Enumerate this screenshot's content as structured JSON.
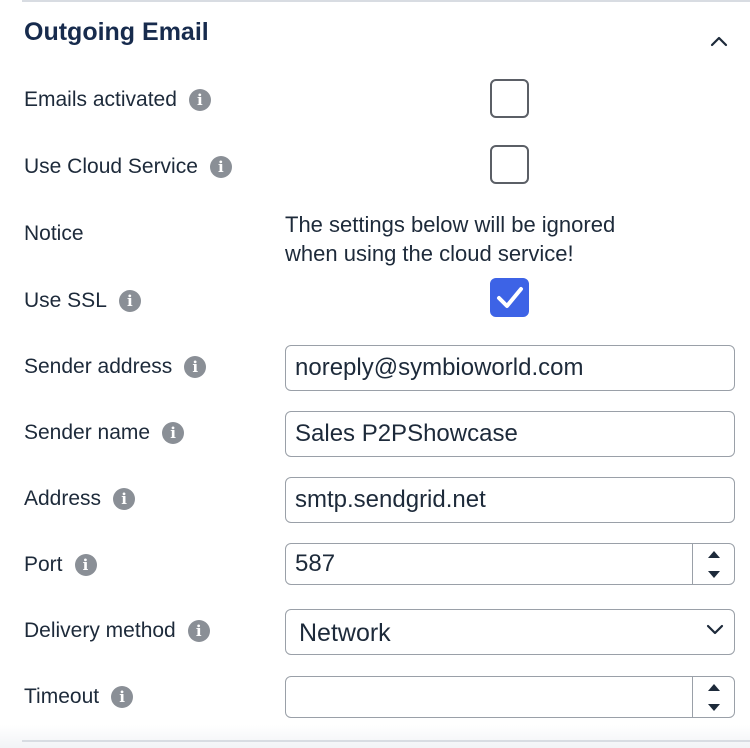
{
  "section": {
    "title": "Outgoing Email"
  },
  "fields": {
    "emails_activated": {
      "label": "Emails activated",
      "checked": false
    },
    "use_cloud_service": {
      "label": "Use Cloud Service",
      "checked": false
    },
    "notice": {
      "label": "Notice",
      "text_line1": "The settings below will be ignored",
      "text_line2": "when using the cloud service!"
    },
    "use_ssl": {
      "label": "Use SSL",
      "checked": true
    },
    "sender_address": {
      "label": "Sender address",
      "value": "noreply@symbioworld.com"
    },
    "sender_name": {
      "label": "Sender name",
      "value": "Sales P2PShowcase"
    },
    "address": {
      "label": "Address",
      "value": "smtp.sendgrid.net"
    },
    "port": {
      "label": "Port",
      "value": "587"
    },
    "delivery_method": {
      "label": "Delivery method",
      "value": "Network"
    },
    "timeout": {
      "label": "Timeout",
      "value": ""
    }
  },
  "icons": {
    "info": "info-icon",
    "collapse": "chevron-up-icon",
    "dropdown": "chevron-down-icon",
    "check": "checkmark-icon"
  },
  "colors": {
    "accent": "#3d63e6",
    "info_icon": "#8a8f96",
    "text": "#1d2a3a"
  }
}
